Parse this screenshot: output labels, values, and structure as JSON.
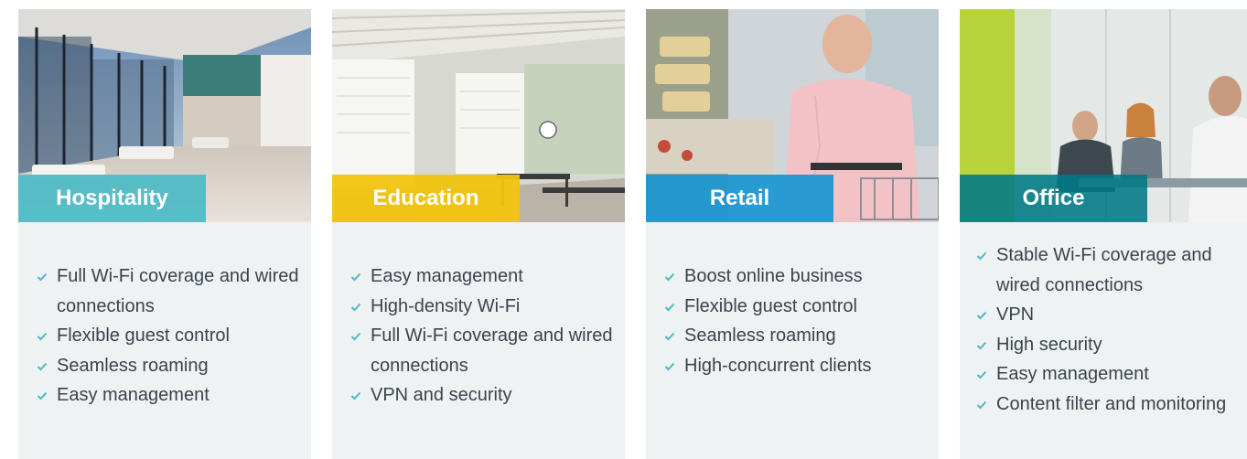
{
  "colors": {
    "card_bg": "#eff2f3",
    "check": "#4bbac4",
    "hospitality": "#4bbac4",
    "education": "#f1c40f",
    "retail": "#1a96d2",
    "office": "#007986"
  },
  "cards": [
    {
      "title": "Hospitality",
      "image": "hotel-lobby-photo",
      "features": [
        "Full Wi-Fi coverage and wired connections",
        "Flexible guest control",
        "Seamless roaming",
        "Easy management"
      ]
    },
    {
      "title": "Education",
      "image": "classroom-photo",
      "features": [
        "Easy management",
        "High-density Wi-Fi",
        "Full Wi-Fi coverage and wired connections",
        "VPN and security"
      ]
    },
    {
      "title": "Retail",
      "image": "store-shopper-photo",
      "features": [
        "Boost online business",
        "Flexible guest control",
        "Seamless roaming",
        "High-concurrent clients"
      ]
    },
    {
      "title": "Office",
      "image": "office-meeting-photo",
      "features": [
        "Stable Wi-Fi coverage and wired connections",
        "VPN",
        "High security",
        "Easy management",
        "Content filter and monitoring"
      ]
    }
  ]
}
